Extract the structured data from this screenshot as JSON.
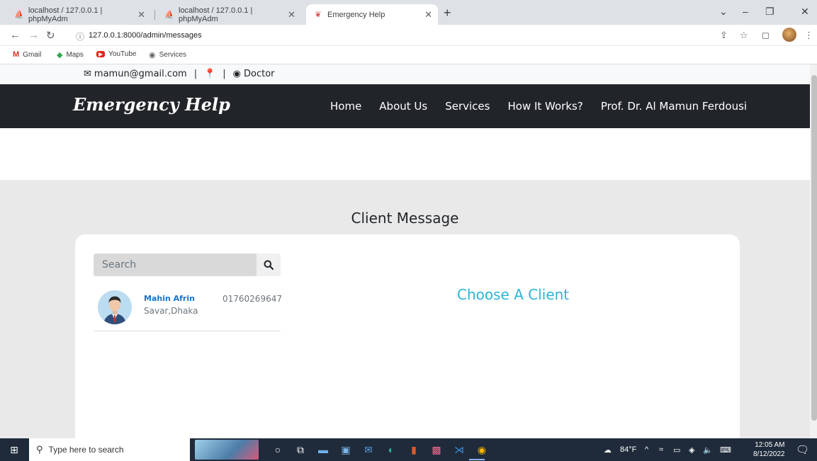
{
  "browser": {
    "tabs": [
      {
        "title": "localhost / 127.0.0.1 | phpMyAdm",
        "active": false
      },
      {
        "title": "localhost / 127.0.0.1 | phpMyAdm",
        "active": false
      },
      {
        "title": "Emergency Help",
        "active": true
      }
    ],
    "url": "127.0.0.1:8000/admin/messages",
    "bookmarks": [
      "Gmail",
      "Maps",
      "YouTube",
      "Services"
    ]
  },
  "topinfo": {
    "email": "mamun@gmail.com",
    "role": "Doctor"
  },
  "navbar": {
    "brand": "Emergency Help",
    "links": [
      "Home",
      "About Us",
      "Services",
      "How It Works?",
      "Prof. Dr. Al Mamun Ferdousi"
    ]
  },
  "main": {
    "title": "Client Message",
    "search_placeholder": "Search",
    "clients": [
      {
        "name": "Mahin Afrin",
        "location": "Savar,Dhaka",
        "phone": "01760269647"
      }
    ],
    "choose_text": "Choose A Client"
  },
  "taskbar": {
    "search_placeholder": "Type here to search",
    "weather": "84°F",
    "time": "12:05 AM",
    "date": "8/12/2022"
  },
  "colors": {
    "navbar": "#212529",
    "accent": "#2bb5d8",
    "client_name": "#1a73c8",
    "section_bg": "#e9e9ea"
  }
}
